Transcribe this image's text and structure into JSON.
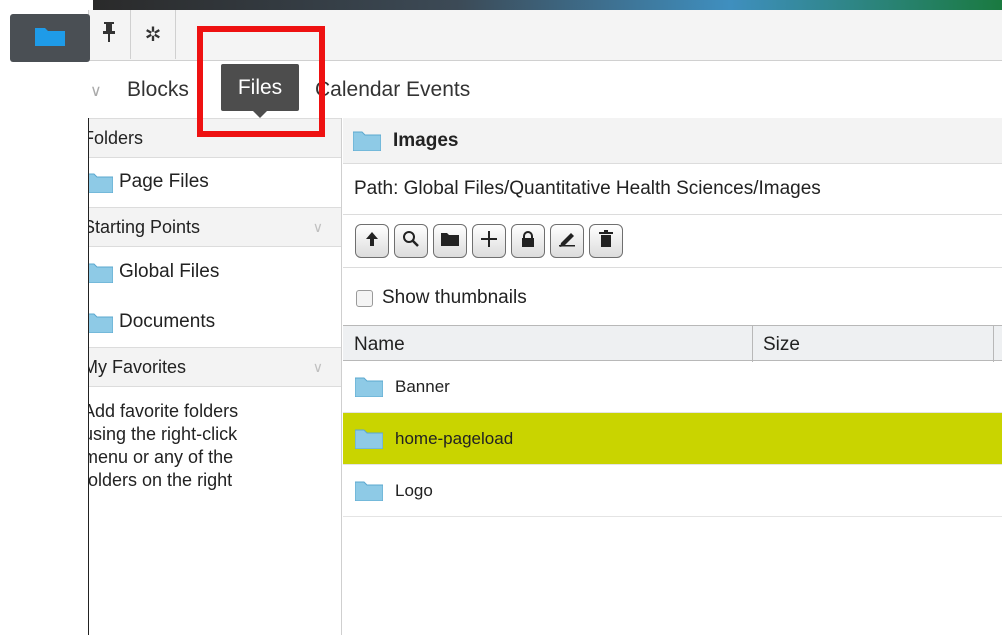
{
  "toolbar": {
    "folder_icon": "folder-icon",
    "pin_icon": "pin-icon",
    "gear_icon": "gear-icon"
  },
  "tabs": [
    {
      "label": "Blocks"
    },
    {
      "label": "Files",
      "active": true
    },
    {
      "label": "Calendar Events"
    }
  ],
  "left_panel": {
    "folders_header": "Folders",
    "folder_items": [
      {
        "label": "Page Files"
      }
    ],
    "starting_points_header": "Starting Points",
    "starting_points": [
      {
        "label": "Global Files"
      },
      {
        "label": "Documents"
      }
    ],
    "favorites_header": "My Favorites",
    "favorites_hint": "Add favorite folders using the right-click menu or any of the folders on the right"
  },
  "right_panel": {
    "title": "Images",
    "path": "Path: Global Files/Quantitative Health Sciences/Images",
    "actions": [
      "up-arrow-icon",
      "search-icon",
      "folder-icon",
      "plus-icon",
      "lock-icon",
      "edit-icon",
      "trash-icon"
    ],
    "show_thumbnails_label": "Show thumbnails",
    "show_thumbnails_checked": false,
    "columns": [
      "Name",
      "Size"
    ],
    "rows": [
      {
        "name": "Banner",
        "size": ""
      },
      {
        "name": "home-pageload",
        "size": "",
        "selected": true
      },
      {
        "name": "Logo",
        "size": ""
      }
    ]
  },
  "colors": {
    "selected_row": "#c9d400",
    "active_tab": "#4d4d4d",
    "highlight_box": "#ee1111",
    "folder_icon_blue": "#1e9be8"
  }
}
